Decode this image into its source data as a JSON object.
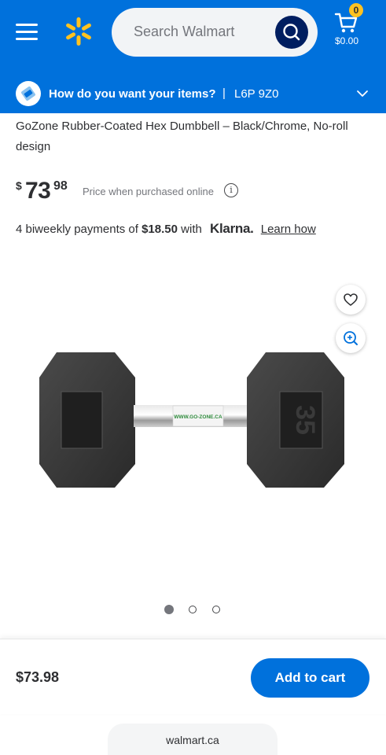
{
  "header": {
    "search_placeholder": "Search Walmart",
    "cart_count": "0",
    "cart_total": "$0.00"
  },
  "delivery": {
    "question": "How do you want your items?",
    "separator": "|",
    "postal_code": "L6P 9Z0"
  },
  "product": {
    "title": "GoZone Rubber-Coated Hex Dumbbell – Black/Chrome, No-roll design",
    "price_symbol": "$",
    "price_dollars": "73",
    "price_cents": "98",
    "price_note": "Price when purchased online",
    "info_icon": "i",
    "handle_label": "WWW.GO-ZONE.CA",
    "weight_mark": "35"
  },
  "klarna": {
    "prefix": "4 biweekly payments of",
    "amount": "$18.50",
    "with": "with",
    "logo": "Klarna.",
    "learn_link": "Learn how"
  },
  "gallery": {
    "total": 3,
    "active": 0
  },
  "bottom_bar": {
    "price": "$73.98",
    "add_to_cart": "Add to cart"
  },
  "browser": {
    "url": "walmart.ca"
  },
  "colors": {
    "brand_blue": "#0071dc",
    "dark_blue": "#001e60",
    "spark_yellow": "#ffc220"
  },
  "icons": [
    "menu-icon",
    "spark-logo-icon",
    "search-icon",
    "cart-icon",
    "delivery-icon",
    "chevron-down-icon",
    "info-icon",
    "heart-icon",
    "zoom-in-icon"
  ]
}
